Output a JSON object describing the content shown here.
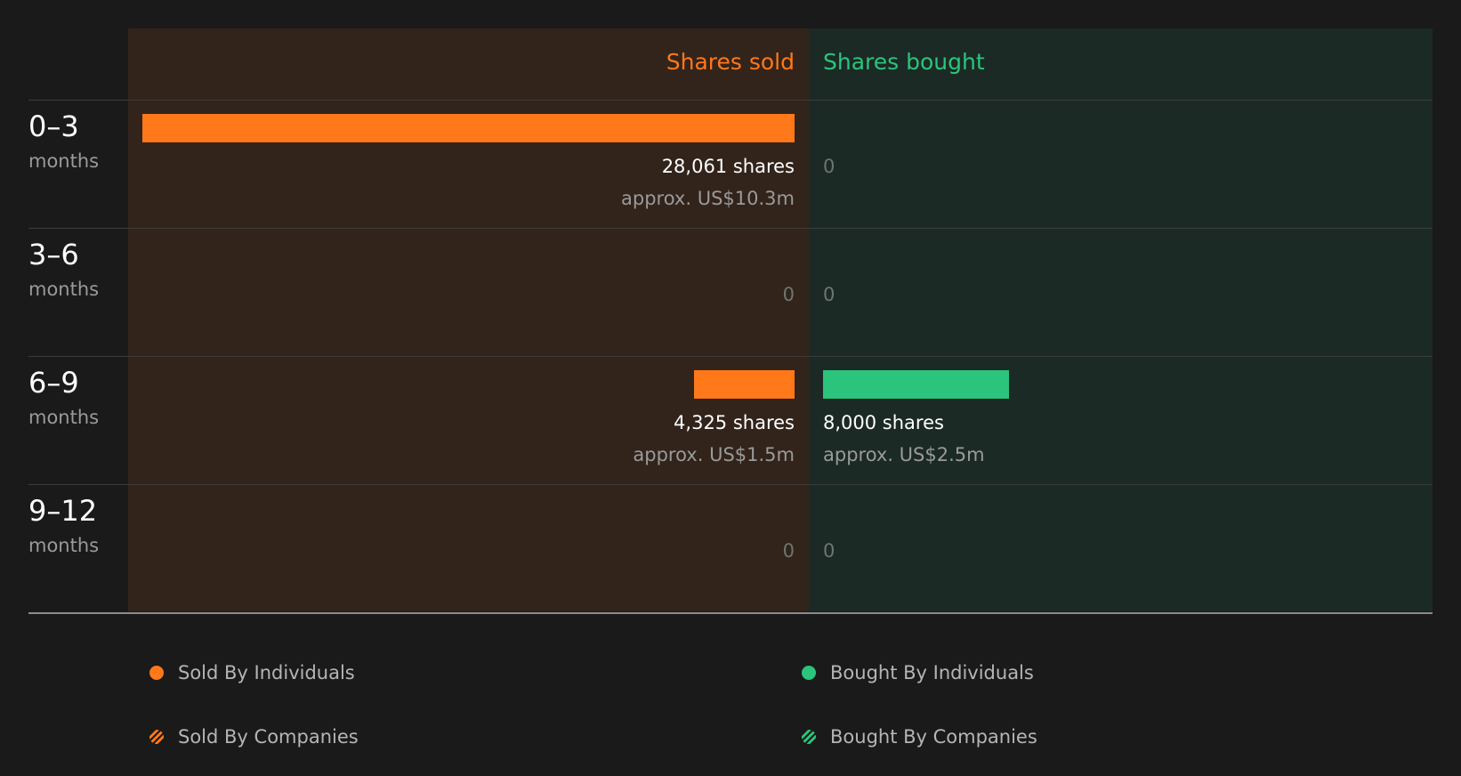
{
  "colors": {
    "sold": "#ff7819",
    "bought": "#2bc47d",
    "sold_panel": "#32241b",
    "bought_panel": "#1b2a24"
  },
  "chart_data": {
    "type": "bar",
    "headers": {
      "sold": "Shares sold",
      "bought": "Shares bought"
    },
    "rows": [
      {
        "range": "0–3",
        "unit": "months",
        "sold": 28061,
        "sold_shares": "28,061 shares",
        "sold_approx": "approx. US$10.3m",
        "bought": 0,
        "bought_shares": "0",
        "bought_approx": ""
      },
      {
        "range": "3–6",
        "unit": "months",
        "sold": 0,
        "sold_shares": "0",
        "sold_approx": "",
        "bought": 0,
        "bought_shares": "0",
        "bought_approx": ""
      },
      {
        "range": "6–9",
        "unit": "months",
        "sold": 4325,
        "sold_shares": "4,325 shares",
        "sold_approx": "approx. US$1.5m",
        "bought": 8000,
        "bought_shares": "8,000 shares",
        "bought_approx": "approx. US$2.5m"
      },
      {
        "range": "9–12",
        "unit": "months",
        "sold": 0,
        "sold_shares": "0",
        "sold_approx": "",
        "bought": 0,
        "bought_shares": "0",
        "bought_approx": ""
      }
    ],
    "max_value": 28061,
    "legend": [
      {
        "label": "Sold By Individuals",
        "style": "dot",
        "color": "#ff7819"
      },
      {
        "label": "Bought By Individuals",
        "style": "dot",
        "color": "#2bc47d"
      },
      {
        "label": "Sold By Companies",
        "style": "hatched",
        "color": "#ff7819"
      },
      {
        "label": "Bought By Companies",
        "style": "hatched",
        "color": "#2bc47d"
      }
    ]
  }
}
